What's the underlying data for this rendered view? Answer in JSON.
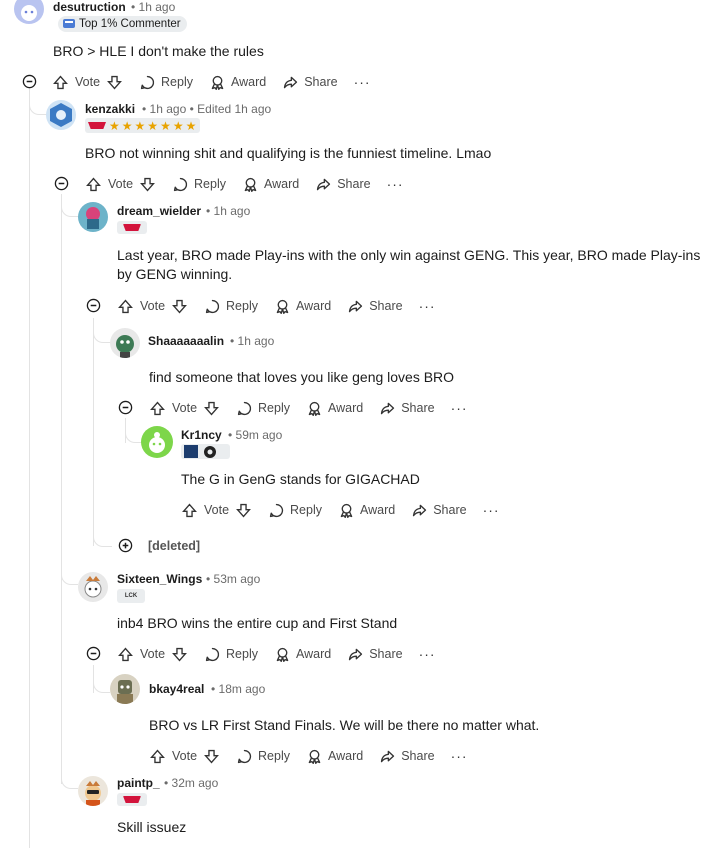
{
  "actions": {
    "vote": "Vote",
    "reply": "Reply",
    "award": "Award",
    "share": "Share",
    "more": "···"
  },
  "comments": [
    {
      "author": "desutruction",
      "time": "1h ago",
      "badge": "Top 1% Commenter",
      "body": "BRO > HLE I don't make the rules"
    },
    {
      "author": "kenzakki",
      "time": "1h ago",
      "edited": "Edited 1h ago",
      "body": "BRO not winning shit and qualifying is the funniest timeline. Lmao"
    },
    {
      "author": "dream_wielder",
      "time": "1h ago",
      "body": "Last year, BRO made Play-ins with the only win against GENG. This year, BRO made Play-ins by GENG winning."
    },
    {
      "author": "Shaaaaaaalin",
      "time": "1h ago",
      "body": "find someone that loves you like geng loves BRO"
    },
    {
      "author": "Kr1ncy",
      "time": "59m ago",
      "body": "The G in GenG stands for GIGACHAD"
    },
    {
      "deleted_label": "[deleted]"
    },
    {
      "author": "Sixteen_Wings",
      "time": "53m ago",
      "flair": "LCK",
      "body": "inb4 BRO wins the entire cup and First Stand"
    },
    {
      "author": "bkay4real",
      "time": "18m ago",
      "body": "BRO vs LR First Stand Finals. We will be there no matter what."
    },
    {
      "author": "paintp_",
      "time": "32m ago",
      "body": "Skill issuez"
    }
  ],
  "separator": "•",
  "colors": {
    "accent_red": "#d3143c",
    "thread_line": "#e3e3e3",
    "meta_gray": "#6b6b6b"
  }
}
